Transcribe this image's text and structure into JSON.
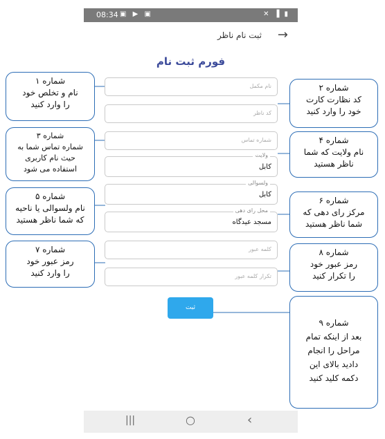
{
  "status_bar": {
    "time": "08:34",
    "left_icons": "▣ ▶ ▣",
    "right_icons": "✕ ▐ ▮"
  },
  "app_bar": {
    "title": "ثبت نام ناظر",
    "back_icon": "arrow-back-icon"
  },
  "form": {
    "title": "فورم ثبت نام",
    "full_name_placeholder": "نام مکمل",
    "observer_code_placeholder": "کد ناظر",
    "phone_placeholder": "شماره تماس",
    "province_label": "ولایت",
    "province_value": "کابل",
    "district_label": "ولسوالی",
    "district_value": "کابل",
    "polling_center_label": "محل رای دهی",
    "polling_center_value": "مسجد عیدگاه",
    "password_placeholder": "کلمه عبور",
    "confirm_password_placeholder": "تکرار کلمه عبور",
    "submit_label": "ثبت"
  },
  "callouts": [
    {
      "lines": [
        "شماره ۱",
        "نام و تخلص خود",
        "را وارد کنید"
      ]
    },
    {
      "lines": [
        "شماره ۲",
        "کد نظارت کارت",
        "خود را وارد کنید"
      ]
    },
    {
      "lines": [
        "شماره ۳",
        "شماره تماس شما به",
        "حیث نام کاربری",
        "استفاده می شود"
      ]
    },
    {
      "lines": [
        "شماره ۴",
        "نام ولایت که شما",
        "ناظر هستید"
      ]
    },
    {
      "lines": [
        "شماره ۵",
        "نام ولسوالی یا ناحیه",
        "که شما ناظر هستید"
      ]
    },
    {
      "lines": [
        "شماره ۶",
        "مرکز رای دهی که",
        "شما ناظر هستید"
      ]
    },
    {
      "lines": [
        "شماره ۷",
        "رمز عبور خود",
        "را وارد کنید"
      ]
    },
    {
      "lines": [
        "شماره ۸",
        "رمز عبور خود",
        "را تکرار کنید"
      ]
    },
    {
      "lines": [
        "شماره ۹",
        "بعد از اینکه تمام",
        "مراحل را انجام",
        "دادید بالای این",
        "دکمه کلید کنید"
      ]
    }
  ],
  "nav_bar": {
    "recent": "|||",
    "home": "○",
    "back": "‹"
  },
  "colors": {
    "callout_border": "#2b6cb5",
    "submit": "#2fa8ec",
    "title": "#3b4a9a"
  }
}
